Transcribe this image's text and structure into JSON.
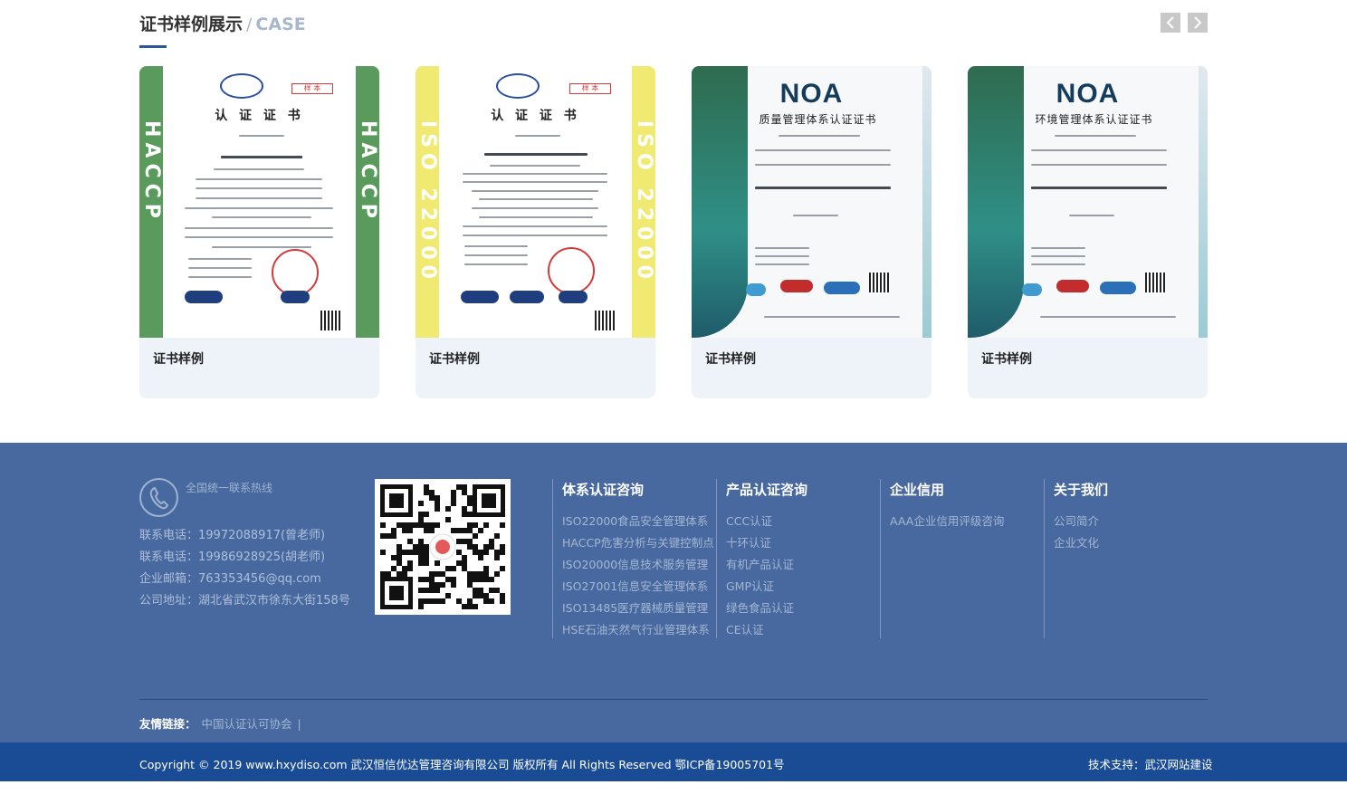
{
  "case_section": {
    "title": "证书样例展示",
    "separator": "/",
    "title_en": "CASE",
    "prev_icon": "chevron-left-icon",
    "next_icon": "chevron-right-icon"
  },
  "cards": [
    {
      "caption": "证书样例",
      "cert_title": "认 证 证 书",
      "side_text": "HACCP",
      "stamp": "样 本",
      "stripe_color": "#5a9a5c"
    },
    {
      "caption": "证书样例",
      "cert_title": "认 证 证 书",
      "side_text": "ISO 22000",
      "stamp": "样 本",
      "stripe_color": "#f0ea72"
    },
    {
      "caption": "证书样例",
      "logo_text": "NOA",
      "cert_title": "质量管理体系认证证书"
    },
    {
      "caption": "证书样例",
      "logo_text": "NOA",
      "cert_title": "环境管理体系认证证书"
    }
  ],
  "footer": {
    "hotline_label": "全国统一联系热线",
    "phone_icon": "phone-icon",
    "contacts": [
      "联系电话：19972088917(曾老师)",
      "联系电话：19986928925(胡老师)",
      "企业邮箱：763353456@qq.com",
      "公司地址：湖北省武汉市徐东大街158号"
    ],
    "columns": [
      {
        "title": "体系认证咨询",
        "items": [
          "ISO22000食品安全管理体系",
          "HACCP危害分析与关键控制点",
          "ISO20000信息技术服务管理",
          "ISO27001信息安全管理体系",
          "ISO13485医疗器械质量管理",
          "HSE石油天然气行业管理体系"
        ]
      },
      {
        "title": "产品认证咨询",
        "items": [
          "CCC认证",
          "十环认证",
          "有机产品认证",
          "GMP认证",
          "绿色食品认证",
          "CE认证"
        ]
      },
      {
        "title": "企业信用",
        "items": [
          "AAA企业信用评级咨询"
        ]
      },
      {
        "title": "关于我们",
        "items": [
          "公司简介",
          "企业文化"
        ]
      }
    ],
    "friend_links_label": "友情链接：",
    "friend_links": [
      "中国认证认可协会"
    ],
    "link_separator": "|",
    "copyright": "Copyright © 2019 www.hxydiso.com  武汉恒信优达管理咨询有限公司 版权所有 All Rights Reserved 鄂ICP备19005701号",
    "support": "技术支持：武汉网站建设"
  }
}
